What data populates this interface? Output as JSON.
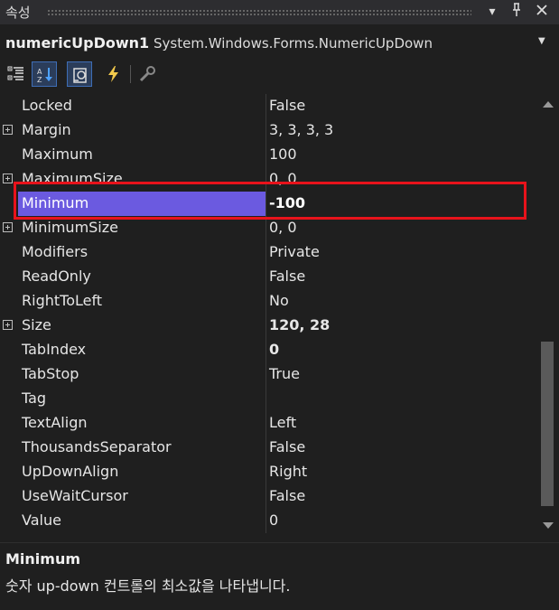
{
  "window": {
    "title": "속성",
    "buttons": [
      "▼",
      "📌",
      "✕"
    ]
  },
  "object_selector": {
    "name": "numericUpDown1",
    "type": "System.Windows.Forms.NumericUpDown"
  },
  "toolbar": {
    "tools": [
      "categorized-icon",
      "alphabetical-icon",
      "properties-icon",
      "events-icon",
      "property-pages-icon"
    ]
  },
  "properties": [
    {
      "name": "Locked",
      "value": "False",
      "expandable": false,
      "bold": false
    },
    {
      "name": "Margin",
      "value": "3, 3, 3, 3",
      "expandable": true,
      "bold": false
    },
    {
      "name": "Maximum",
      "value": "100",
      "expandable": false,
      "bold": false
    },
    {
      "name": "MaximumSize",
      "value": "0, 0",
      "expandable": true,
      "bold": false
    },
    {
      "name": "Minimum",
      "value": "-100",
      "expandable": false,
      "bold": true,
      "selected": true
    },
    {
      "name": "MinimumSize",
      "value": "0, 0",
      "expandable": true,
      "bold": false
    },
    {
      "name": "Modifiers",
      "value": "Private",
      "expandable": false,
      "bold": false
    },
    {
      "name": "ReadOnly",
      "value": "False",
      "expandable": false,
      "bold": false
    },
    {
      "name": "RightToLeft",
      "value": "No",
      "expandable": false,
      "bold": false
    },
    {
      "name": "Size",
      "value": "120, 28",
      "expandable": true,
      "bold": true
    },
    {
      "name": "TabIndex",
      "value": "0",
      "expandable": false,
      "bold": true
    },
    {
      "name": "TabStop",
      "value": "True",
      "expandable": false,
      "bold": false
    },
    {
      "name": "Tag",
      "value": "",
      "expandable": false,
      "bold": false
    },
    {
      "name": "TextAlign",
      "value": "Left",
      "expandable": false,
      "bold": false
    },
    {
      "name": "ThousandsSeparator",
      "value": "False",
      "expandable": false,
      "bold": false
    },
    {
      "name": "UpDownAlign",
      "value": "Right",
      "expandable": false,
      "bold": false
    },
    {
      "name": "UseWaitCursor",
      "value": "False",
      "expandable": false,
      "bold": false
    },
    {
      "name": "Value",
      "value": "0",
      "expandable": false,
      "bold": false
    }
  ],
  "description": {
    "title": "Minimum",
    "text": "숫자 up-down 컨트롤의 최소값을 나타냅니다."
  },
  "colors": {
    "background": "#1f1f1f",
    "selection": "#6b5ae0",
    "highlight_box": "#e8131b"
  }
}
